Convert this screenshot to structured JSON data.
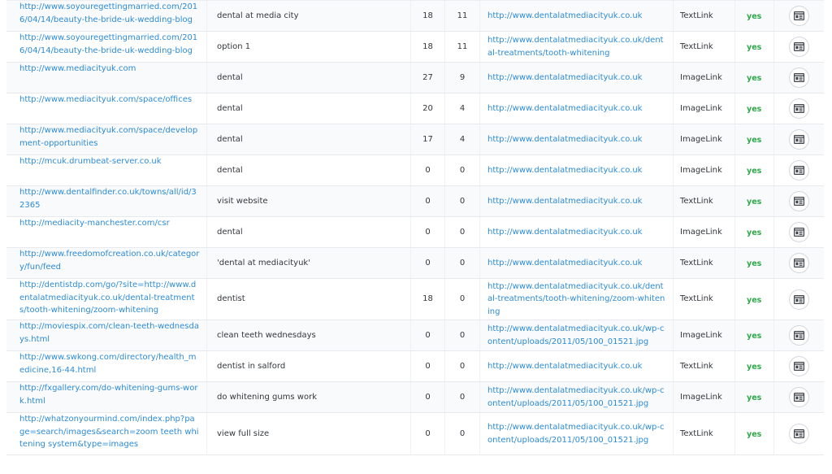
{
  "table": {
    "rows": [
      {
        "source": "http://www.soyouregettingmarried.com/2016/04/14/beauty-the-bride-uk-wedding-blog",
        "anchor": "dental at media city",
        "col3": "18",
        "col4": "11",
        "target": "http://www.dentalatmediacityuk.co.uk",
        "link_type": "TextLink",
        "follow": "yes",
        "action_icon": "details-card-icon"
      },
      {
        "source": "http://www.soyouregettingmarried.com/2016/04/14/beauty-the-bride-uk-wedding-blog",
        "anchor": "option 1",
        "col3": "18",
        "col4": "11",
        "target": "http://www.dentalatmediacityuk.co.uk/dental-treatments/tooth-whitening",
        "link_type": "TextLink",
        "follow": "yes",
        "action_icon": "details-card-icon"
      },
      {
        "source": "http://www.mediacityuk.com",
        "anchor": "dental",
        "col3": "27",
        "col4": "9",
        "target": "http://www.dentalatmediacityuk.co.uk",
        "link_type": "ImageLink",
        "follow": "yes",
        "action_icon": "details-card-icon"
      },
      {
        "source": "http://www.mediacityuk.com/space/offices",
        "anchor": "dental",
        "col3": "20",
        "col4": "4",
        "target": "http://www.dentalatmediacityuk.co.uk",
        "link_type": "ImageLink",
        "follow": "yes",
        "action_icon": "details-card-icon"
      },
      {
        "source": "http://www.mediacityuk.com/space/development-opportunities",
        "anchor": "dental",
        "col3": "17",
        "col4": "4",
        "target": "http://www.dentalatmediacityuk.co.uk",
        "link_type": "ImageLink",
        "follow": "yes",
        "action_icon": "details-card-icon"
      },
      {
        "source": "http://mcuk.drumbeat-server.co.uk",
        "anchor": "dental",
        "col3": "0",
        "col4": "0",
        "target": "http://www.dentalatmediacityuk.co.uk",
        "link_type": "ImageLink",
        "follow": "yes",
        "action_icon": "details-card-icon"
      },
      {
        "source": "http://www.dentalfinder.co.uk/towns/all/id/32365",
        "anchor": "visit website",
        "col3": "0",
        "col4": "0",
        "target": "http://www.dentalatmediacityuk.co.uk",
        "link_type": "TextLink",
        "follow": "yes",
        "action_icon": "details-card-icon"
      },
      {
        "source": "http://mediacity-manchester.com/csr",
        "anchor": "dental",
        "col3": "0",
        "col4": "0",
        "target": "http://www.dentalatmediacityuk.co.uk",
        "link_type": "ImageLink",
        "follow": "yes",
        "action_icon": "details-card-icon"
      },
      {
        "source": "http://www.freedomofcreation.co.uk/category/fun/feed",
        "anchor": "'dental at mediacityuk'",
        "col3": "0",
        "col4": "0",
        "target": "http://www.dentalatmediacityuk.co.uk",
        "link_type": "TextLink",
        "follow": "yes",
        "action_icon": "details-card-icon"
      },
      {
        "source": "http://dentistdp.com/go/?site=http://www.dentalatmediacityuk.co.uk/dental-treatments/tooth-whitening/zoom-whitening",
        "anchor": "dentist",
        "col3": "18",
        "col4": "0",
        "target": "http://www.dentalatmediacityuk.co.uk/dental-treatments/tooth-whitening/zoom-whitening",
        "link_type": "TextLink",
        "follow": "yes",
        "action_icon": "details-card-icon"
      },
      {
        "source": "http://moviespix.com/clean-teeth-wednesdays.html",
        "anchor": "clean teeth wednesdays",
        "col3": "0",
        "col4": "0",
        "target": "http://www.dentalatmediacityuk.co.uk/wp-content/uploads/2011/05/100_01521.jpg",
        "link_type": "ImageLink",
        "follow": "yes",
        "action_icon": "details-card-icon"
      },
      {
        "source": "http://www.swkong.com/directory/health_medicine,16-44.html",
        "anchor": "dentist in salford",
        "col3": "0",
        "col4": "0",
        "target": "http://www.dentalatmediacityuk.co.uk",
        "link_type": "TextLink",
        "follow": "yes",
        "action_icon": "details-card-icon"
      },
      {
        "source": "http://fxgallery.com/do-whitening-gums-work.html",
        "anchor": "do whitening gums work",
        "col3": "0",
        "col4": "0",
        "target": "http://www.dentalatmediacityuk.co.uk/wp-content/uploads/2011/05/100_01521.jpg",
        "link_type": "ImageLink",
        "follow": "yes",
        "action_icon": "details-card-icon"
      },
      {
        "source": "http://whatzonyourmind.com/index.php?page=search/images&search=zoom teeth whitening system&type=images",
        "anchor": "view full size",
        "col3": "0",
        "col4": "0",
        "target": "http://www.dentalatmediacityuk.co.uk/wp-content/uploads/2011/05/100_01521.jpg",
        "link_type": "TextLink",
        "follow": "yes",
        "action_icon": "details-card-icon"
      }
    ]
  },
  "colors": {
    "link": "#2c8bd6",
    "follow_yes": "#2ea84a",
    "text": "#33363b",
    "row_alt": "#f9fafb",
    "divider": "#e7e9ec"
  }
}
